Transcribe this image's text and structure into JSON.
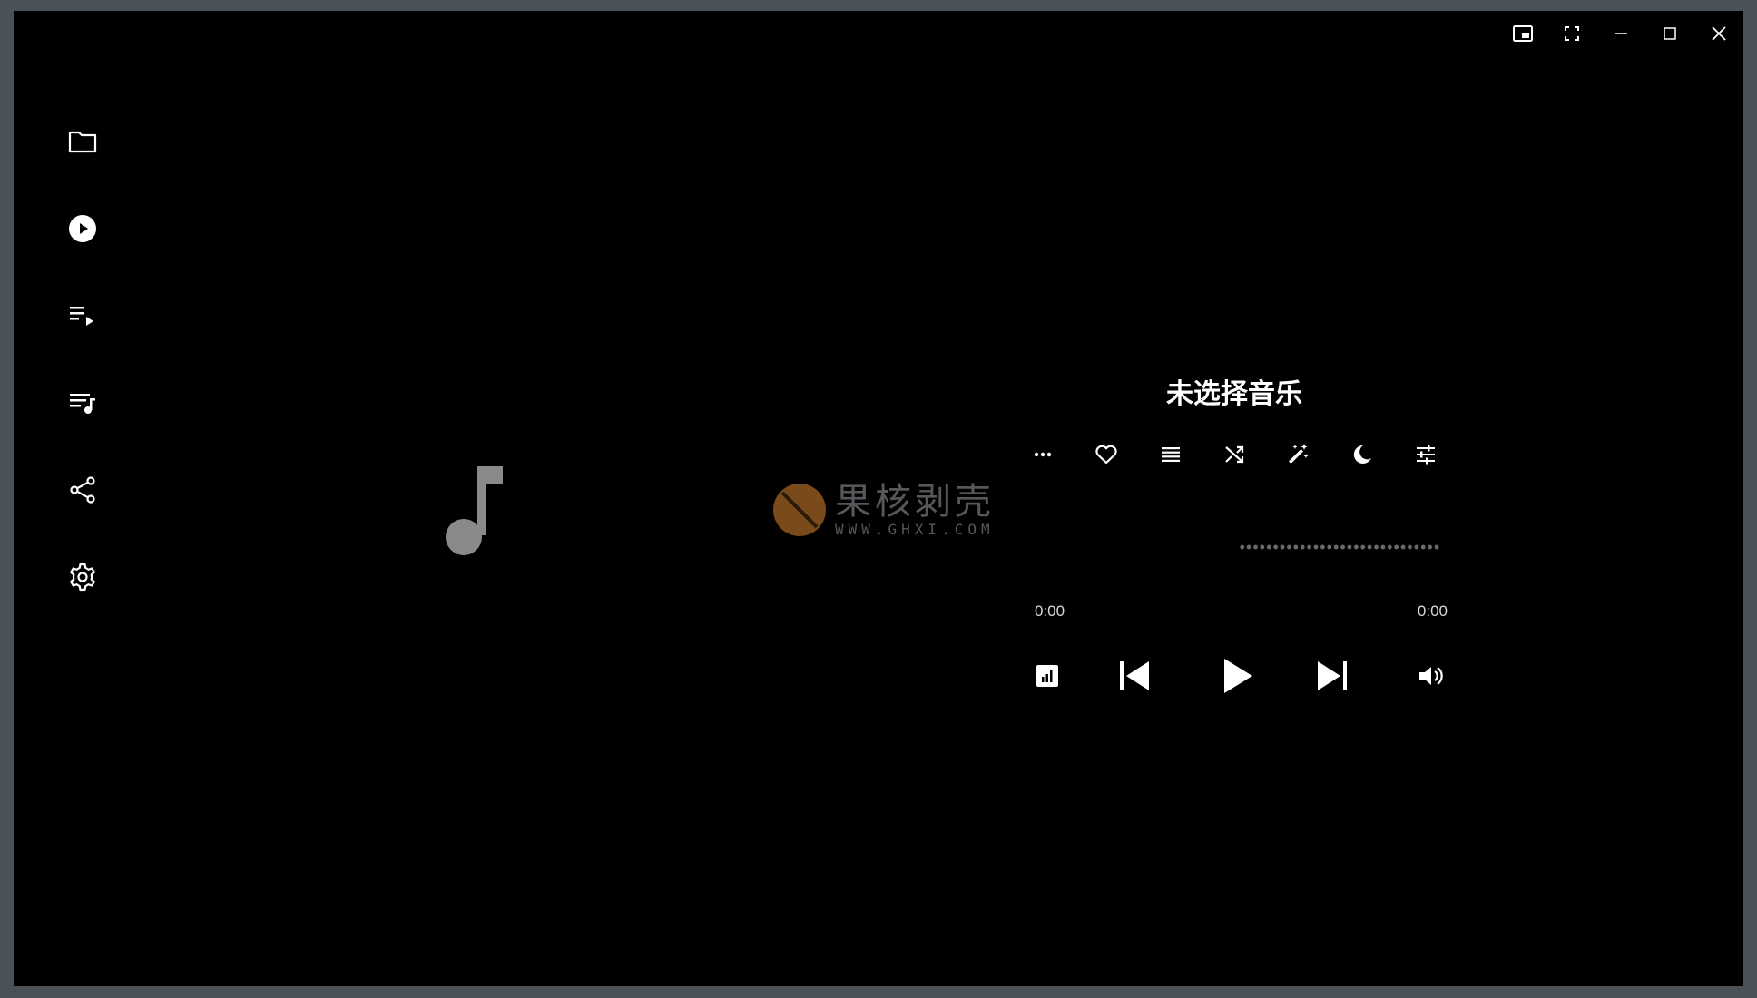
{
  "window": {
    "controls": [
      {
        "name": "picture-in-picture-icon"
      },
      {
        "name": "fullscreen-icon"
      },
      {
        "name": "minimize-icon"
      },
      {
        "name": "maximize-icon"
      },
      {
        "name": "close-icon"
      }
    ]
  },
  "sidebar": {
    "items": [
      {
        "icon": "folder-icon"
      },
      {
        "icon": "now-playing-icon",
        "active": true
      },
      {
        "icon": "queue-icon"
      },
      {
        "icon": "playlist-music-icon"
      },
      {
        "icon": "share-icon"
      },
      {
        "icon": "settings-icon"
      }
    ]
  },
  "artwork": {
    "icon": "music-note-icon"
  },
  "watermark": {
    "title": "果核剥壳",
    "url": "WWW.GHXI.COM"
  },
  "player": {
    "title": "未选择音乐",
    "actions": [
      "more-icon",
      "heart-icon",
      "list-icon",
      "shuffle-icon",
      "magic-wand-icon",
      "sleep-timer-icon",
      "equalizer-icon"
    ],
    "progress": 0,
    "time_current": "0:00",
    "time_total": "0:00",
    "transport": [
      "visualizer-icon",
      "previous-icon",
      "play-icon",
      "next-icon",
      "volume-icon"
    ]
  },
  "colors": {
    "background": "#000000",
    "frame": "#4a5257",
    "foreground": "#ffffff",
    "muted": "#8a8a8a",
    "watermark_logo": "#7a4a1a"
  }
}
